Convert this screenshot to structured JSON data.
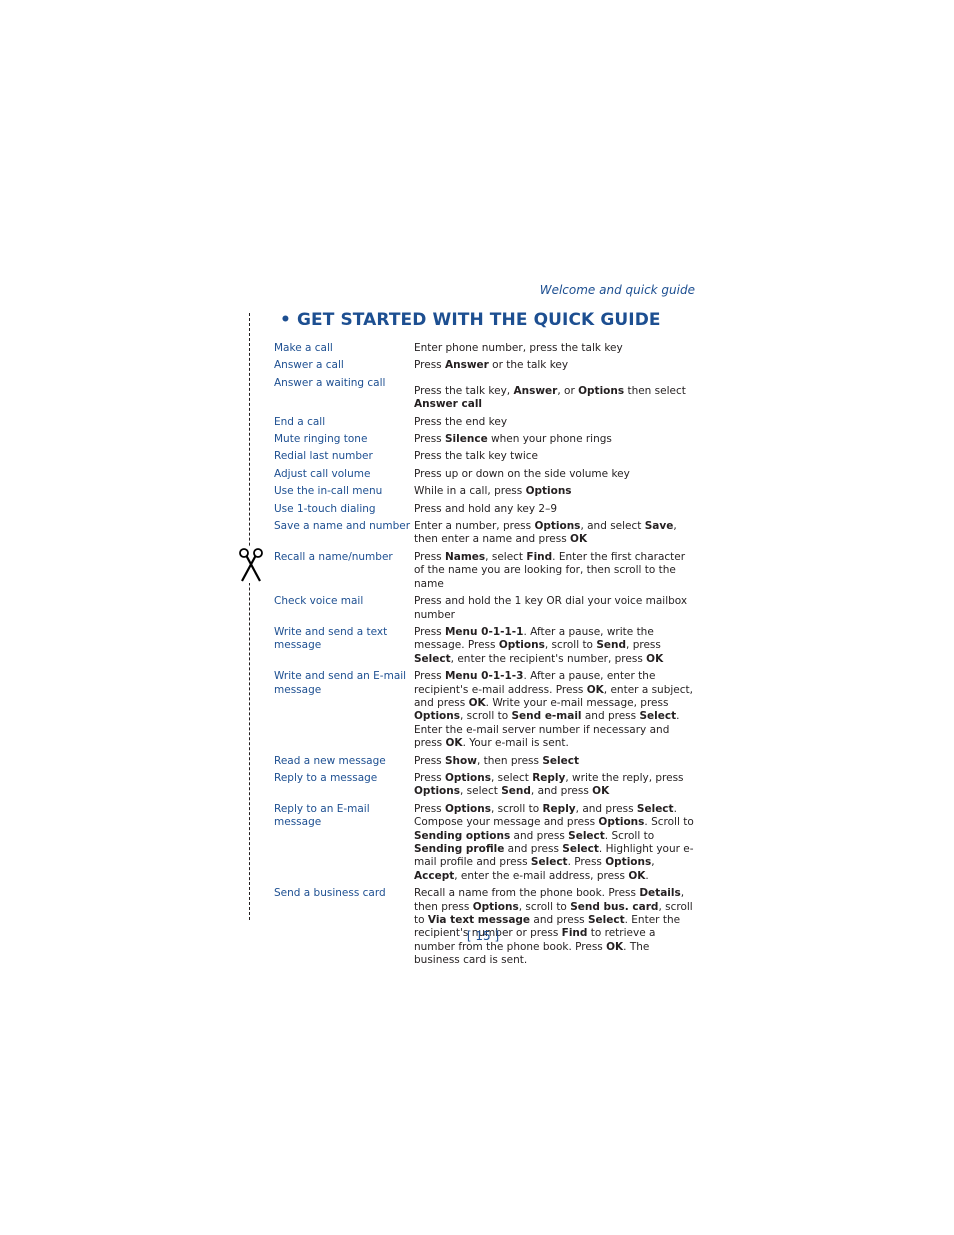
{
  "header": {
    "running_head": "Welcome and quick guide"
  },
  "section": {
    "bullet": "•",
    "title": "GET STARTED WITH THE QUICK GUIDE"
  },
  "icons": {
    "cut_line": "dashed-cut-line",
    "scissors": "scissors-icon"
  },
  "rows": [
    {
      "task": "Make a call",
      "instruction": "Enter phone number, press the talk key"
    },
    {
      "task": "Answer a call",
      "instruction": "Press **Answer** or the talk key"
    },
    {
      "task": "Answer a waiting call",
      "instruction": "Press the talk key, **Answer**, or **Options** then select **Answer call**"
    },
    {
      "task": "End a call",
      "instruction": "Press the end key"
    },
    {
      "task": "Mute ringing tone",
      "instruction": "Press **Silence** when your phone rings"
    },
    {
      "task": "Redial last number",
      "instruction": "Press the talk key twice"
    },
    {
      "task": "Adjust call volume",
      "instruction": "Press up or down on the side volume key"
    },
    {
      "task": "Use the in-call menu",
      "instruction": "While in a call, press **Options**"
    },
    {
      "task": "Use 1-touch dialing",
      "instruction": "Press and hold any key 2–9"
    },
    {
      "task": "Save a name and number",
      "instruction": "Enter a number, press **Options**, and select **Save**, then enter a name and press **OK**"
    },
    {
      "task": "Recall a name/number",
      "instruction": "Press **Names**, select **Find**. Enter the first character of the name you are looking for, then scroll to the name"
    },
    {
      "task": "Check voice mail",
      "instruction": "Press and hold the 1 key OR dial your voice mailbox number"
    },
    {
      "task": "Write and send a text message",
      "instruction": "Press **Menu 0-1-1-1**. After a pause, write the message. Press **Options**, scroll to **Send**, press **Select**, enter the recipient's number, press **OK**"
    },
    {
      "task": "Write and send an E-mail message",
      "instruction": "Press **Menu 0-1-1-3**. After a pause, enter the recipient's e-mail address. Press **OK**, enter a subject, and press **OK**. Write your e-mail message, press **Options**, scroll to **Send e-mail** and press **Select**. Enter the e-mail server number if necessary and press **OK**. Your e-mail is sent."
    },
    {
      "task": "Read a new message",
      "instruction": "Press **Show**, then press **Select**"
    },
    {
      "task": "Reply to a message",
      "instruction": "Press **Options**, select **Reply**, write the reply, press **Options**, select **Send**, and press **OK**"
    },
    {
      "task": "Reply to an E-mail message",
      "instruction": "Press **Options**, scroll to **Reply**, and press **Select**. Compose your message and press **Options**. Scroll to **Sending options** and press **Select**. Scroll to **Sending profile** and press **Select**. Highlight your e-mail profile and press **Select**. Press **Options**, **Accept**, enter the e-mail address, press **OK**."
    },
    {
      "task": "Send a business card",
      "instruction": "Recall a name from the phone book. Press **Details**, then press **Options**, scroll to **Send bus. card**, scroll to **Via text message** and press **Select**. Enter the recipient's number or press **Find** to retrieve a number from the phone book. Press **OK**. The business card is sent."
    }
  ],
  "footer": {
    "page_number": "[ 15 ]"
  }
}
